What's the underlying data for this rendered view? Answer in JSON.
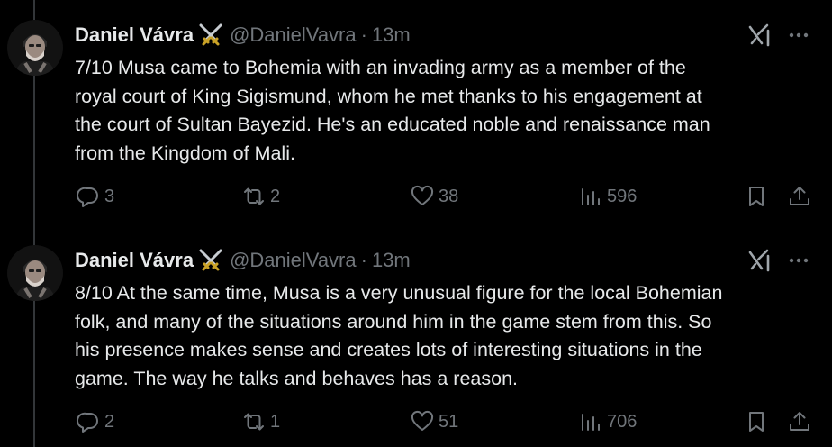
{
  "tweets": [
    {
      "author_name": "Daniel Vávra",
      "handle": "@DanielVavra",
      "separator": "·",
      "time": "13m",
      "text": "7/10 Musa came to Bohemia with an invading army as a member of the\nroyal court of King Sigismund, whom he met thanks to his engagement at\nthe court of Sultan Bayezid. He's an educated noble and renaissance man\nfrom the Kingdom of Mali.",
      "replies": "3",
      "reposts": "2",
      "likes": "38",
      "views": "596"
    },
    {
      "author_name": "Daniel Vávra",
      "handle": "@DanielVavra",
      "separator": "·",
      "time": "13m",
      "text": "8/10 At the same time, Musa is a very unusual figure for the local Bohemian\nfolk, and many of the situations around him in the game stem from this. So\nhis presence makes sense and creates lots of interesting  situations in the\ngame. The way he talks and behaves has a reason.",
      "replies": "2",
      "reposts": "1",
      "likes": "51",
      "views": "706"
    }
  ],
  "icons": {
    "badge": "crossed-swords-icon",
    "grok": "grok-icon",
    "more": "more-icon",
    "reply": "reply-icon",
    "repost": "repost-icon",
    "like": "heart-icon",
    "views": "views-icon",
    "bookmark": "bookmark-icon",
    "share": "share-icon"
  },
  "colors": {
    "background": "#000000",
    "text": "#e7e9ea",
    "secondary": "#71767b",
    "thread_line": "#333639"
  }
}
